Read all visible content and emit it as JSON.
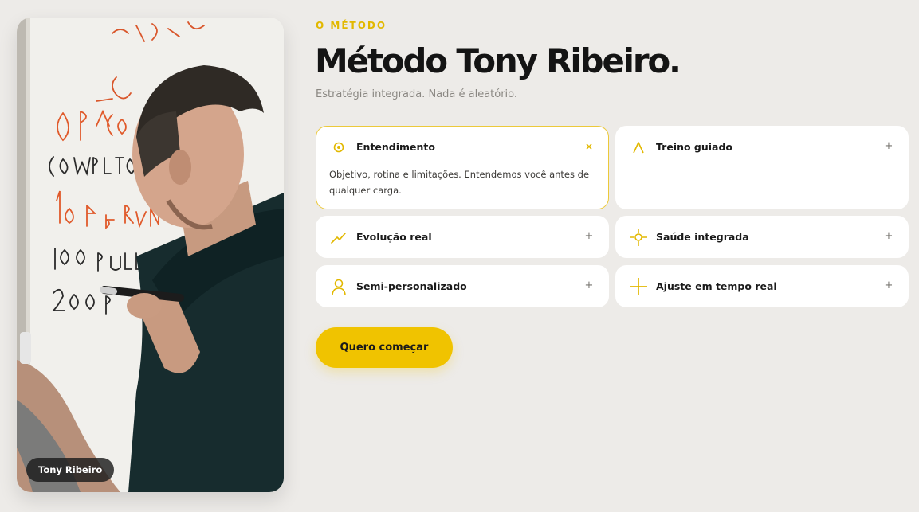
{
  "photo": {
    "caption": "Tony Ribeiro"
  },
  "header": {
    "eyebrow": "O MÉTODO",
    "title": "Método Tony Ribeiro.",
    "subtitle": "Estratégia integrada. Nada é aleatório."
  },
  "cards": [
    {
      "label": "Entendimento",
      "icon": "target-icon",
      "toggle": "×",
      "expanded": true,
      "description": "Objetivo, rotina e limitações. Entendemos você antes de qualquer carga."
    },
    {
      "label": "Treino guiado",
      "icon": "a-letter-icon",
      "toggle": "+",
      "expanded": false
    },
    {
      "label": "Evolução real",
      "icon": "trend-up-icon",
      "toggle": "+",
      "expanded": false
    },
    {
      "label": "Saúde integrada",
      "icon": "crosshair-icon",
      "toggle": "+",
      "expanded": false
    },
    {
      "label": "Semi-personalizado",
      "icon": "user-icon",
      "toggle": "+",
      "expanded": false
    },
    {
      "label": "Ajuste em tempo real",
      "icon": "plus-cross-icon",
      "toggle": "+",
      "expanded": false
    }
  ],
  "cta": {
    "label": "Quero começar"
  },
  "colors": {
    "accent": "#f0c300",
    "background": "#edebe8",
    "card": "#ffffff"
  }
}
